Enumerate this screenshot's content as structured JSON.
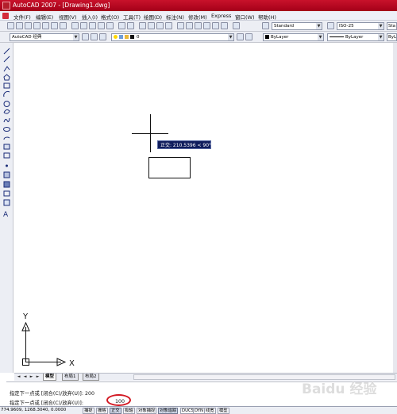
{
  "window": {
    "title": "AutoCAD 2007 - [Drawing1.dwg]"
  },
  "menu": [
    "文件(F)",
    "编辑(E)",
    "视图(V)",
    "插入(I)",
    "格式(O)",
    "工具(T)",
    "绘图(D)",
    "标注(N)",
    "修改(M)",
    "Express",
    "窗口(W)",
    "帮助(H)"
  ],
  "toolbar1": {
    "text_style": "Standard",
    "dim_style": "ISO-25",
    "table_style": "Sta"
  },
  "toolbar2": {
    "workspace": "AutoCAD 经典",
    "layer": "0",
    "color": "ByLayer",
    "linetype": "ByLayer",
    "lineweight": "ByL"
  },
  "canvas": {
    "tooltip": "正交: 210.5396 < 90°",
    "ucs_y_label": "Y",
    "ucs_x_label": "X"
  },
  "tabs": {
    "model": "模型",
    "layout1": "布局1",
    "layout2": "布局2"
  },
  "command_line": {
    "line1": "指定下一点或 [闭合(C)/放弃(U)]: 200",
    "line2": "指定下一点或 [闭合(C)/放弃(U)]:",
    "line2_value": "100"
  },
  "status_bar": {
    "coordinates": "774.9609, 1268.3040, 0.0000",
    "buttons": [
      "捕捉",
      "栅格",
      "正交",
      "极轴",
      "对象捕捉",
      "对象追踪",
      "DUCS",
      "DYN",
      "线宽",
      "模型"
    ],
    "active": [
      "正交",
      "对象追踪"
    ]
  },
  "watermark": "Baidu 经验",
  "colors": {
    "titlebar": "#c8122b",
    "tooltip_bg": "#101d5d",
    "highlight": "#d31822"
  }
}
